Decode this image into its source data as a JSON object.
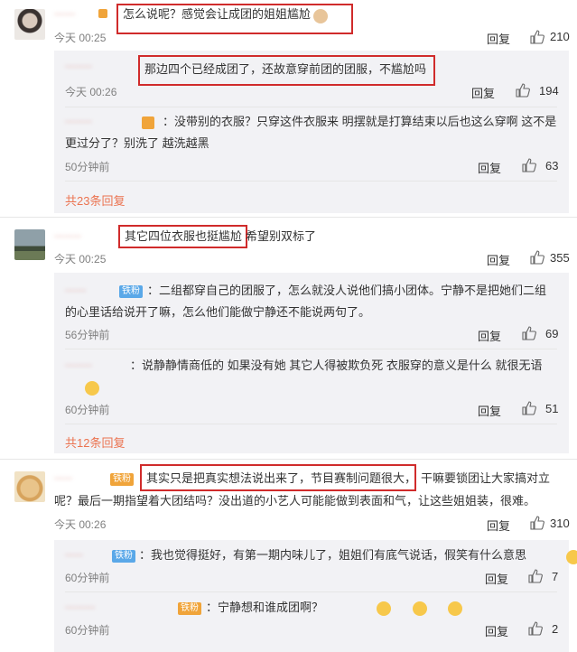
{
  "c1": {
    "name": "∙∙∙∙∙∙∙",
    "text": "怎么说呢？感觉会让成团的姐姐尴尬",
    "time": "今天 00:25",
    "reply": "回复",
    "likes": "210"
  },
  "c1r1": {
    "name": "∙∙∙∙∙∙∙∙∙",
    "text": "那边四个已经成团了，还故意穿前团的团服，不尴尬吗",
    "time": "今天 00:26",
    "reply": "回复",
    "likes": "194"
  },
  "c1r2": {
    "name": "∙∙∙∙∙∙∙∙∙",
    "text1": "：没带别的衣服？只穿这件衣服来 明摆就是打算结束以后也这么穿啊 这不是",
    "text2": "更过分了？别洗了 越洗越黑",
    "time": "50分钟前",
    "reply": "回复",
    "likes": "63"
  },
  "c1more": "共23条回复",
  "c2": {
    "name": "∙∙∙∙∙∙∙∙∙",
    "text_boxed": "其它四位衣服也挺尴尬",
    "text_rest": "希望别双标了",
    "time": "今天 00:25",
    "reply": "回复",
    "likes": "355"
  },
  "c2r1": {
    "name": "∙∙∙∙∙∙∙",
    "badge": "铁粉",
    "text1": "：二组都穿自己的团服了，怎么就没人说他们搞小团体。宁静不是把她们二组",
    "text2": "的心里话给说开了嘛，怎么他们能做宁静还不能说两句了。",
    "time": "56分钟前",
    "reply": "回复",
    "likes": "69"
  },
  "c2r2": {
    "name": "∙∙∙∙∙∙∙∙∙",
    "text1": "：说静静情商低的 如果没有她 其它人得被欺负死 衣服穿的意义是什么 就很无语",
    "time": "60分钟前",
    "reply": "回复",
    "likes": "51"
  },
  "c2more": "共12条回复",
  "c3": {
    "name": "∙∙∙∙∙∙",
    "badge": "铁粉",
    "text_boxed": "其实只是把真实想法说出来了，节目赛制问题很大，",
    "text1_rest": "干嘛要锁团让大家搞对立",
    "text2": "呢？最后一期指望着大团结吗？没出道的小艺人可能能做到表面和气，让这些姐姐装，很难。",
    "time": "今天 00:26",
    "reply": "回复",
    "likes": "310"
  },
  "c3r1": {
    "name": "∙∙∙∙∙∙",
    "badge": "铁粉",
    "text": "：我也觉得挺好，有第一期内味儿了，姐姐们有底气说话，假笑有什么意思",
    "time": "60分钟前",
    "reply": "回复",
    "likes": "7"
  },
  "c3r2": {
    "name": "∙∙∙∙∙∙∙∙∙∙",
    "badge": "铁粉",
    "text": "：宁静想和谁成团啊？",
    "time": "60分钟前",
    "reply": "回复",
    "likes": "2"
  },
  "colors": {
    "accent": "#eb7350",
    "redbox": "#d02b2b",
    "sub_bg": "#f2f2f5",
    "badge_blue": "#5aa8e8",
    "badge_orange": "#f0a43a"
  },
  "icons": [
    "like-icon",
    "emoji-icon",
    "vip-icon"
  ]
}
